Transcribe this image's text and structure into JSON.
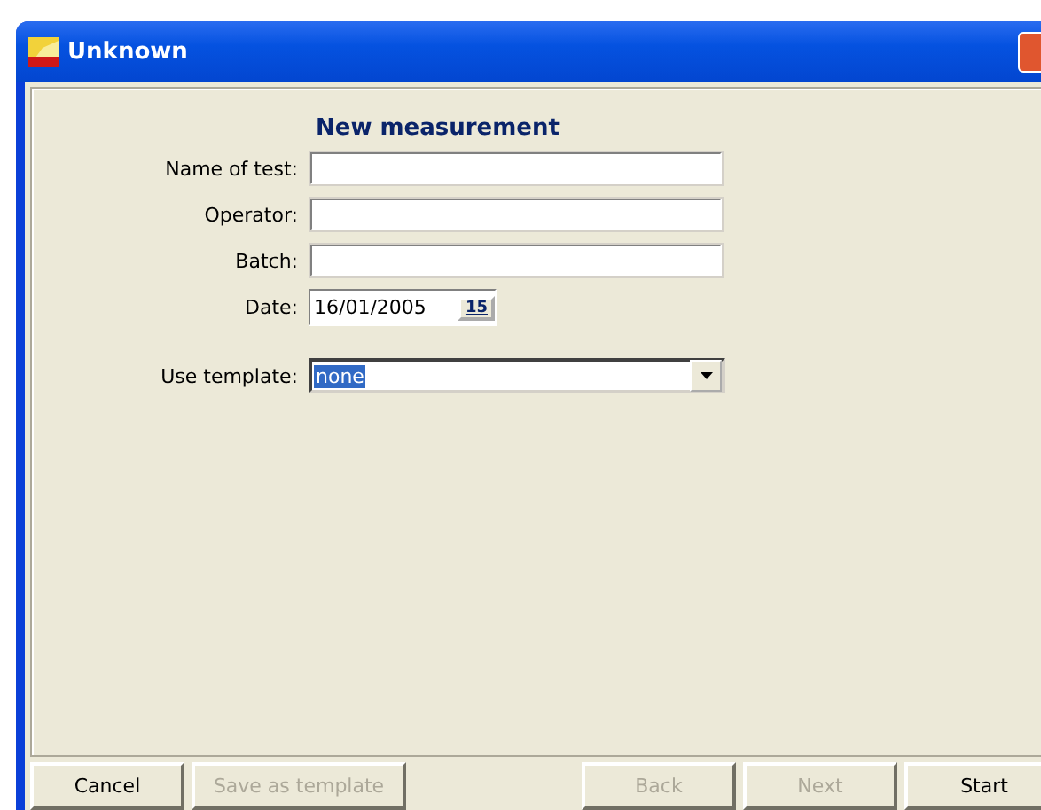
{
  "window": {
    "title": "Unknown"
  },
  "heading": "New measurement",
  "fields": [
    {
      "kind": "text",
      "label": "Name of test:"
    },
    {
      "kind": "text",
      "label": "Operator:"
    },
    {
      "kind": "text",
      "label": "Batch:"
    },
    {
      "kind": "date",
      "label": "Date:",
      "value": "16/01/2005",
      "button": "15"
    }
  ],
  "template": {
    "label": "Use template:",
    "value": "none",
    "selected": true
  },
  "buttons": [
    {
      "label": "Cancel",
      "disabled": false
    },
    {
      "label": "Save as template",
      "disabled": true
    },
    {
      "label": "Back",
      "disabled": true
    },
    {
      "label": "Next",
      "disabled": true
    },
    {
      "label": "Start",
      "disabled": false
    }
  ]
}
